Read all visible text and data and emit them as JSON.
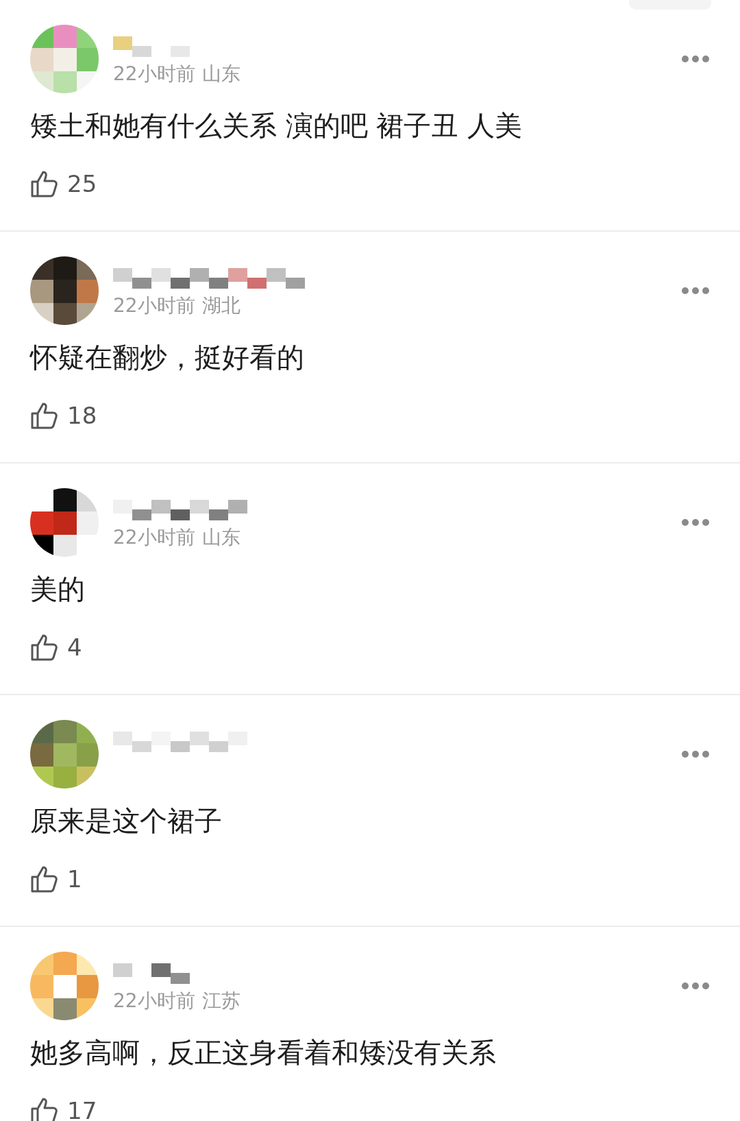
{
  "comments": [
    {
      "time": "22小时前",
      "location": "山东",
      "text": "矮土和她有什么关系 演的吧 裙子丑 人美",
      "likes": "25"
    },
    {
      "time": "22小时前",
      "location": "湖北",
      "text": "怀疑在翻炒，挺好看的",
      "likes": "18"
    },
    {
      "time": "22小时前",
      "location": "山东",
      "text": "美的",
      "likes": "4"
    },
    {
      "text": "原来是这个裙子",
      "likes": "1"
    },
    {
      "time": "22小时前",
      "location": "江苏",
      "text": "她多高啊，反正这身看着和矮没有关系",
      "likes": "17"
    }
  ]
}
